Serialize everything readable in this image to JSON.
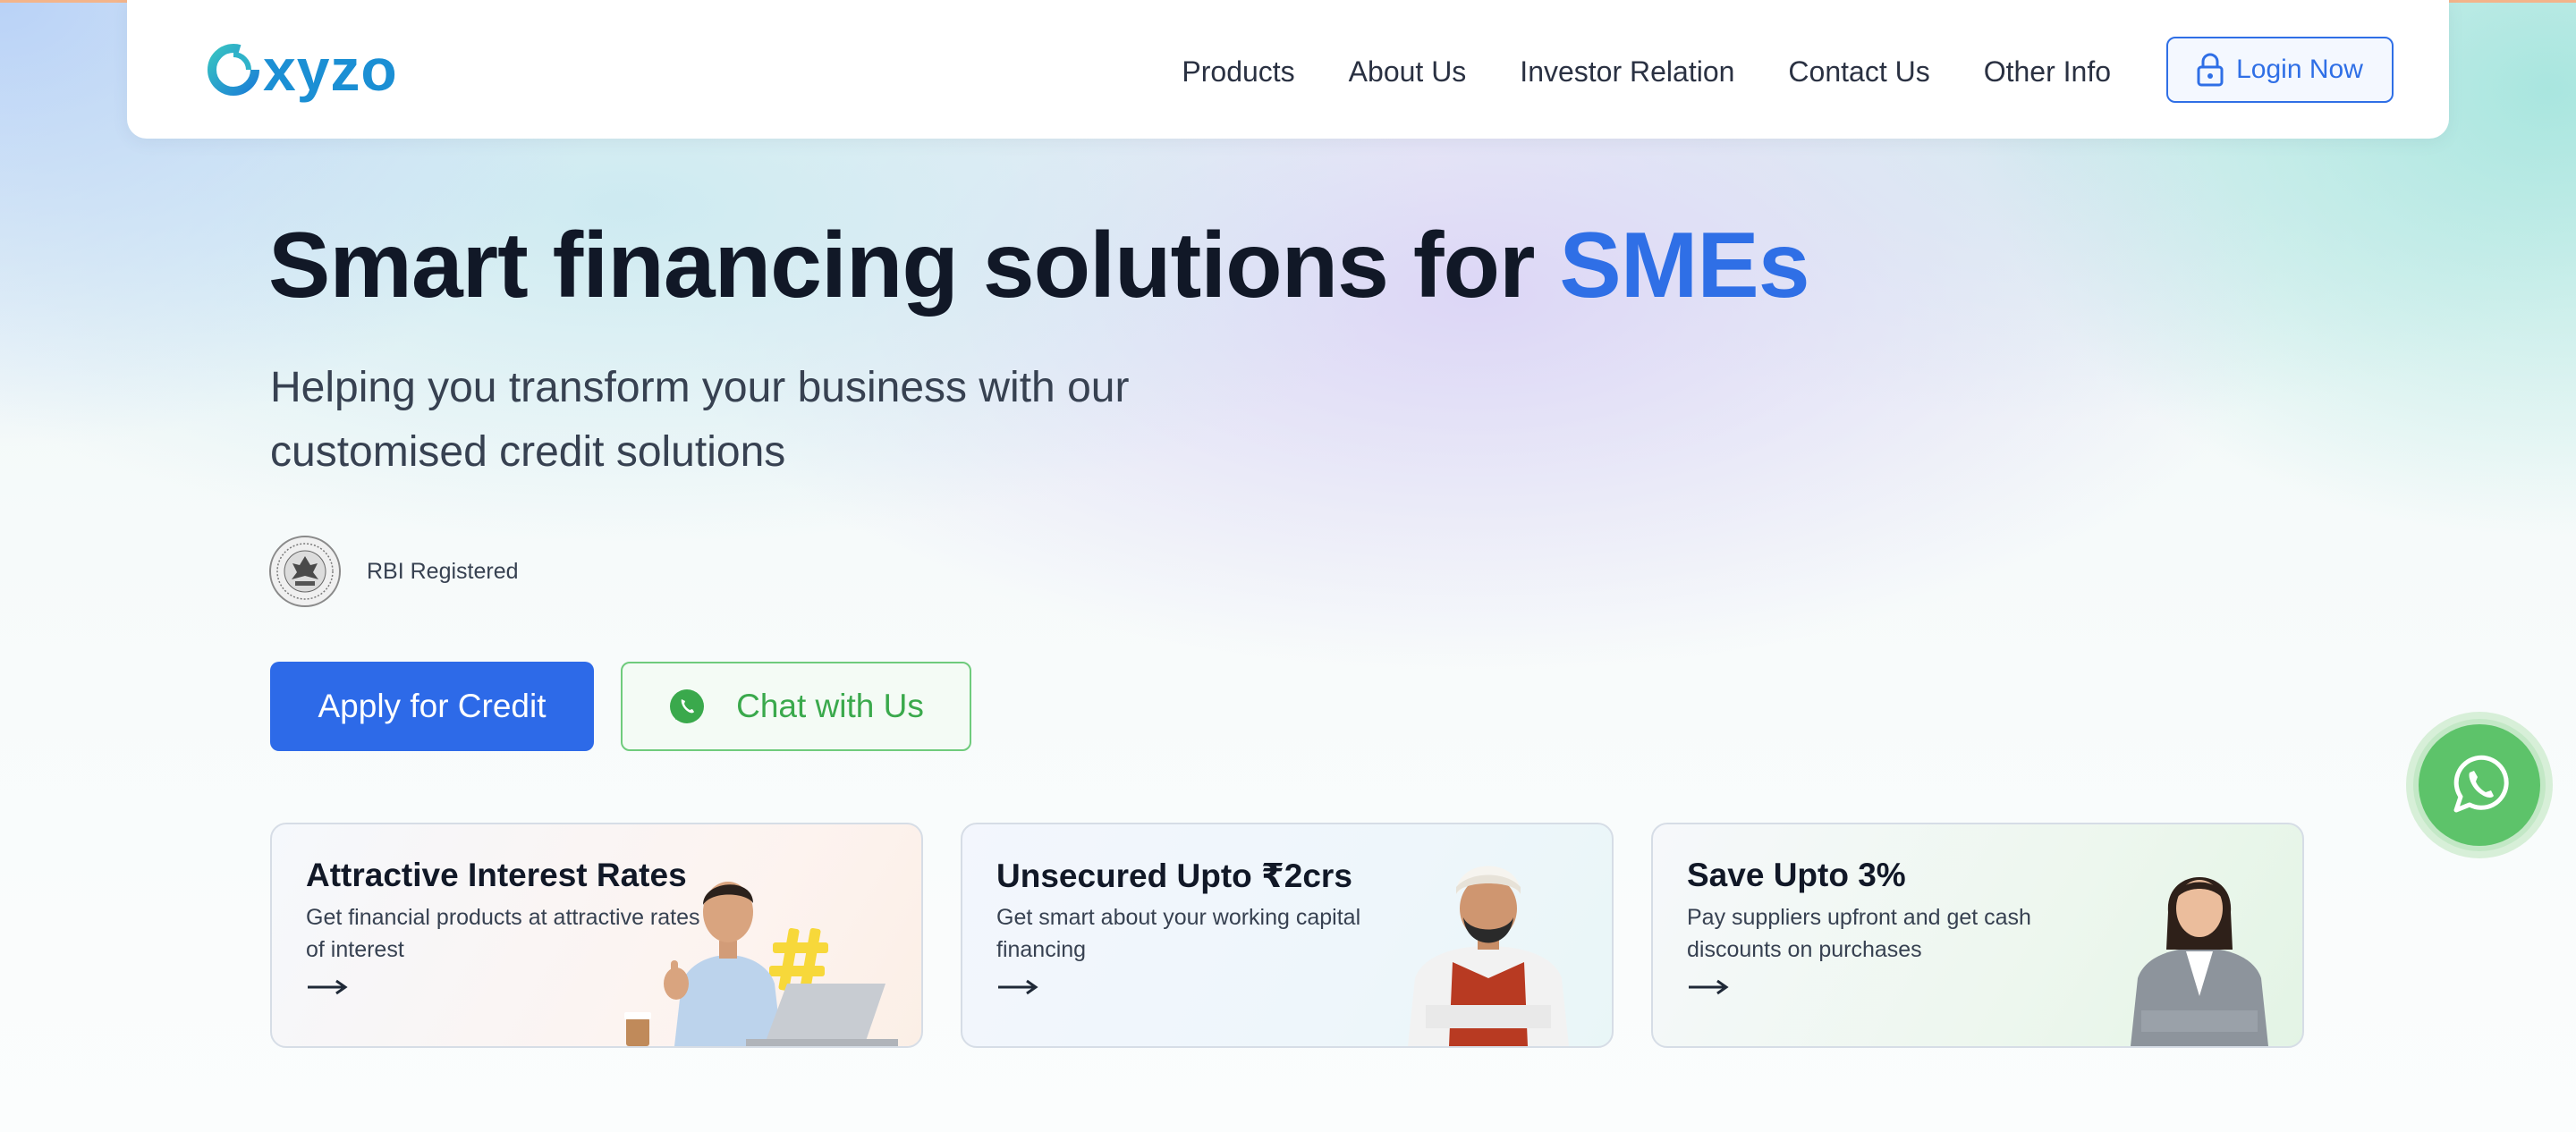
{
  "colors": {
    "primary": "#2d6ae8",
    "accent_text": "#2f6fe6",
    "whatsapp_green": "#5dc36a",
    "heading": "#111827",
    "top_line": "#f3b48a"
  },
  "header": {
    "logo_text": "xyzo",
    "logo_icon": "oxyzo-swirl-logo",
    "nav": [
      "Products",
      "About Us",
      "Investor Relation",
      "Contact Us",
      "Other Info"
    ],
    "login_label": "Login Now",
    "login_icon": "lock-icon"
  },
  "hero": {
    "title_main": "Smart financing solutions for ",
    "title_accent": "SMEs",
    "subtitle_line1": "Helping you transform your business with our",
    "subtitle_line2": "customised credit solutions",
    "badge_icon": "rbi-seal-icon",
    "badge_text": "RBI Registered",
    "apply_label": "Apply for Credit",
    "chat_label": "Chat with Us",
    "chat_icon": "whatsapp-icon"
  },
  "cards": [
    {
      "title": "Attractive Interest Rates",
      "description": "Get financial products at attractive rates of interest",
      "arrow_icon": "arrow-right-icon",
      "image": "man-thumbs-up-with-laptop"
    },
    {
      "title": "Unsecured Upto ₹2crs",
      "description": "Get smart about your working capital financing",
      "arrow_icon": "arrow-right-icon",
      "image": "man-with-turban-arms-crossed"
    },
    {
      "title": "Save Upto 3%",
      "description": "Pay suppliers upfront and get cash discounts on purchases",
      "arrow_icon": "arrow-right-icon",
      "image": "woman-in-suit-arms-crossed"
    }
  ],
  "floating": {
    "whatsapp_icon": "whatsapp-icon"
  }
}
